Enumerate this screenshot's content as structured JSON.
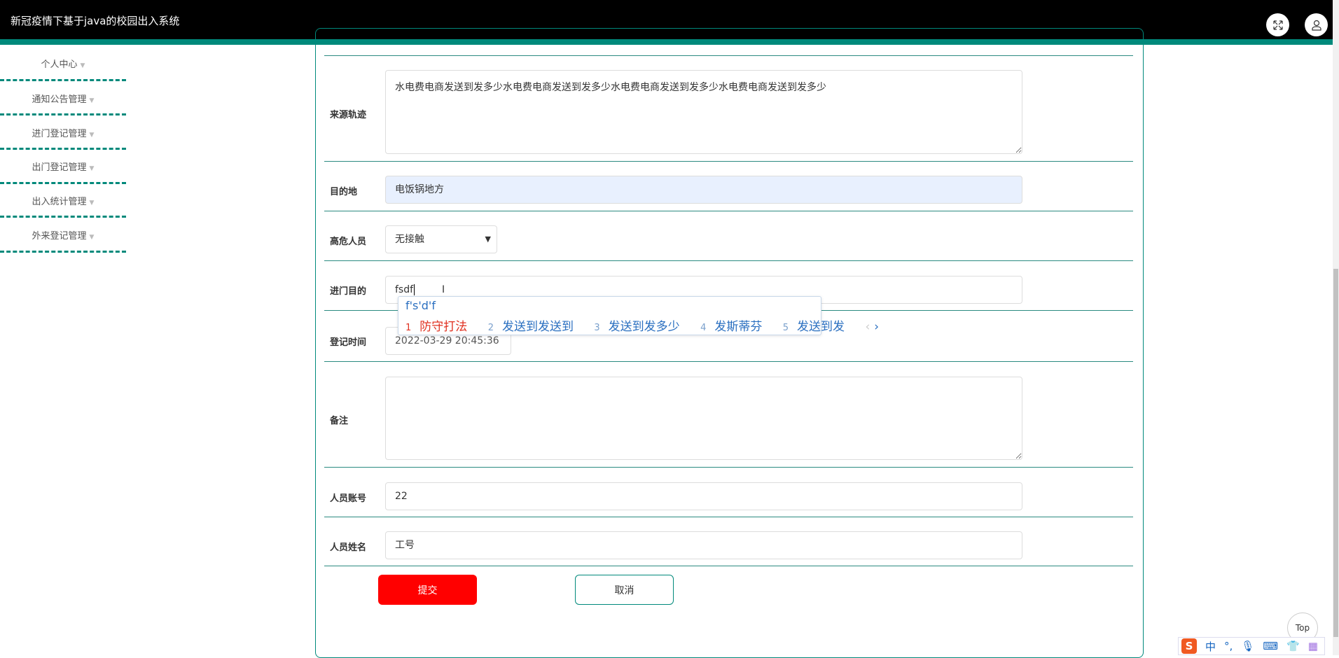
{
  "header": {
    "title": "新冠疫情下基于java的校园出入系统"
  },
  "sidebar": {
    "items": [
      "个人中心",
      "通知公告管理",
      "进门登记管理",
      "出门登记管理",
      "出入统计管理",
      "外来登记管理"
    ]
  },
  "form": {
    "source_label": "来源轨迹",
    "source_value": "水电费电商发送到发多少水电费电商发送到发多少水电费电商发送到发多少水电费电商发送到发多少",
    "dest_label": "目的地",
    "dest_value": "电饭锅地方",
    "risk_label": "高危人员",
    "risk_value": "无接触",
    "purpose_label": "进门目的",
    "purpose_value": "fsdf",
    "time_label": "登记时间",
    "time_value": "2022-03-29 20:45:36",
    "remark_label": "备注",
    "remark_value": "",
    "account_label": "人员账号",
    "account_value": "22",
    "name_label": "人员姓名",
    "name_value": "工号",
    "submit": "提交",
    "cancel": "取消"
  },
  "ime": {
    "composition": "f's'd'f",
    "candidates": [
      {
        "n": "1",
        "text": "防守打法"
      },
      {
        "n": "2",
        "text": "发送到发送到"
      },
      {
        "n": "3",
        "text": "发送到发多少"
      },
      {
        "n": "4",
        "text": "发斯蒂芬"
      },
      {
        "n": "5",
        "text": "发送到发"
      }
    ],
    "next": "›",
    "prev": "‹"
  },
  "top_button": "Top",
  "sogou": {
    "lang": "中",
    "punct": "°,"
  },
  "colors": {
    "accent": "#00897b",
    "submit": "#ff0000"
  }
}
